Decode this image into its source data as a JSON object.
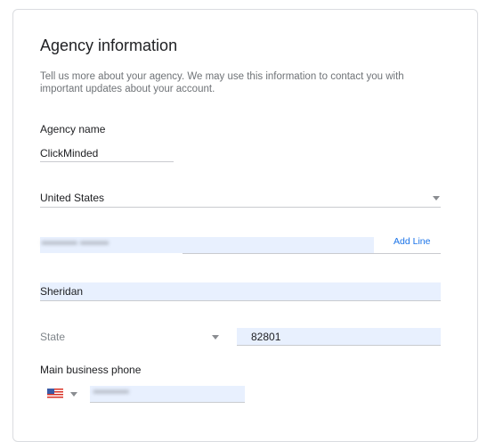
{
  "header": {
    "title": "Agency information",
    "description": "Tell us more about your agency. We may use this information to contact you with important updates about your account."
  },
  "agency_name": {
    "label": "Agency name",
    "value": "ClickMinded"
  },
  "country": {
    "value": "United States",
    "icon": "chevron-down-icon"
  },
  "address": {
    "value": "•••••••••• ••••••••",
    "add_line_label": "Add Line"
  },
  "city": {
    "value": "Sheridan"
  },
  "state": {
    "placeholder": "State",
    "icon": "chevron-down-icon"
  },
  "zip": {
    "value": "82801"
  },
  "phone": {
    "label": "Main business phone",
    "country_flag": "us-flag-icon",
    "value": "••••••••••"
  },
  "colors": {
    "accent": "#1a73e8",
    "autofill_bg": "#e8f0fe",
    "border": "#dadce0"
  }
}
